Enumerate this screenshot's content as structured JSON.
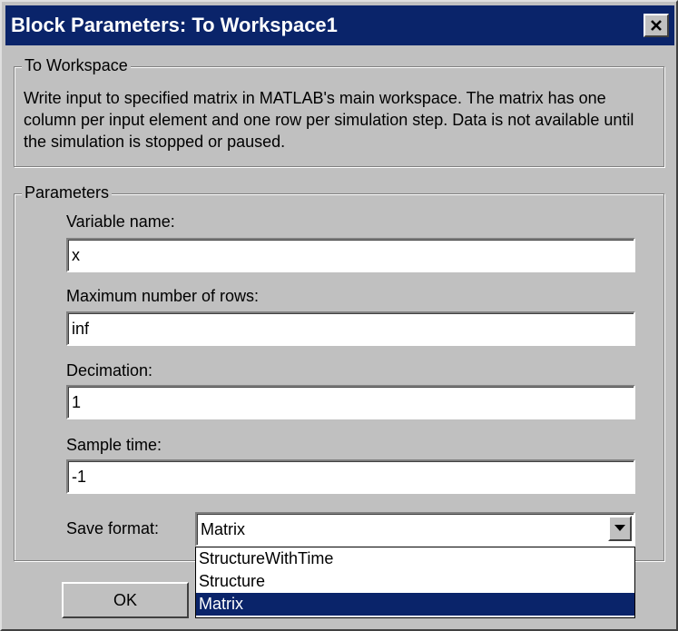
{
  "window": {
    "title": "Block Parameters: To Workspace1",
    "close_icon": "close-icon"
  },
  "description_group": {
    "legend": "To Workspace",
    "text": "Write input to specified matrix in MATLAB's main workspace.  The matrix has one column per input element and one row per simulation step.  Data is not available until the simulation is stopped or paused."
  },
  "parameters_group": {
    "legend": "Parameters",
    "variable_name": {
      "label": "Variable name:",
      "value": "x"
    },
    "max_rows": {
      "label": "Maximum number of rows:",
      "value": "inf"
    },
    "decimation": {
      "label": "Decimation:",
      "value": "1"
    },
    "sample_time": {
      "label": "Sample time:",
      "value": "-1"
    },
    "save_format": {
      "label": "Save format:",
      "value": "Matrix",
      "options": [
        "StructureWithTime",
        "Structure",
        "Matrix"
      ],
      "selected_option": "Matrix"
    }
  },
  "buttons": {
    "ok": "OK"
  },
  "colors": {
    "title_bar": "#0a246a",
    "dialog_bg": "#c0c0c0",
    "selection": "#0a246a"
  }
}
